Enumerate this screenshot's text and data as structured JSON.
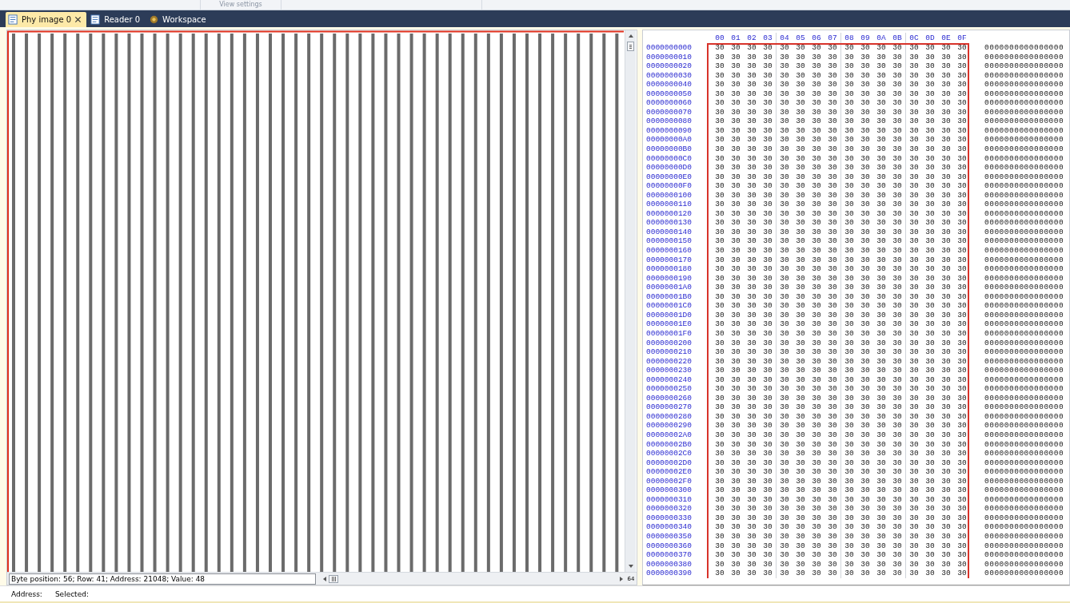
{
  "ribbon": {
    "group_label": "View settings"
  },
  "tabs": [
    {
      "label": "Phy image 0",
      "selected": true,
      "closable": true,
      "kind": "document"
    },
    {
      "label": "Reader 0",
      "selected": false,
      "closable": false,
      "kind": "document"
    },
    {
      "label": "Workspace",
      "selected": false,
      "closable": false,
      "kind": "workspace"
    }
  ],
  "image_view": {
    "status": "Byte position: 56; Row: 41; Address: 21048; Value: 48",
    "zoom": "64"
  },
  "hex_view": {
    "columns": [
      "00",
      "01",
      "02",
      "03",
      "04",
      "05",
      "06",
      "07",
      "08",
      "09",
      "0A",
      "0B",
      "0C",
      "0D",
      "0E",
      "0F"
    ],
    "rows": [
      {
        "address": "0000000000",
        "bytes": [
          "30",
          "30",
          "30",
          "30",
          "30",
          "30",
          "30",
          "30",
          "30",
          "30",
          "30",
          "30",
          "30",
          "30",
          "30",
          "30"
        ],
        "ascii": "0000000000000000"
      },
      {
        "address": "0000000010",
        "bytes": [
          "30",
          "30",
          "30",
          "30",
          "30",
          "30",
          "30",
          "30",
          "30",
          "30",
          "30",
          "30",
          "30",
          "30",
          "30",
          "30"
        ],
        "ascii": "0000000000000000"
      },
      {
        "address": "0000000020",
        "bytes": [
          "30",
          "30",
          "30",
          "30",
          "30",
          "30",
          "30",
          "30",
          "30",
          "30",
          "30",
          "30",
          "30",
          "30",
          "30",
          "30"
        ],
        "ascii": "0000000000000000"
      },
      {
        "address": "0000000030",
        "bytes": [
          "30",
          "30",
          "30",
          "30",
          "30",
          "30",
          "30",
          "30",
          "30",
          "30",
          "30",
          "30",
          "30",
          "30",
          "30",
          "30"
        ],
        "ascii": "0000000000000000"
      },
      {
        "address": "0000000040",
        "bytes": [
          "30",
          "30",
          "30",
          "30",
          "30",
          "30",
          "30",
          "30",
          "30",
          "30",
          "30",
          "30",
          "30",
          "30",
          "30",
          "30"
        ],
        "ascii": "0000000000000000"
      },
      {
        "address": "0000000050",
        "bytes": [
          "30",
          "30",
          "30",
          "30",
          "30",
          "30",
          "30",
          "30",
          "30",
          "30",
          "30",
          "30",
          "30",
          "30",
          "30",
          "30"
        ],
        "ascii": "0000000000000000"
      },
      {
        "address": "0000000060",
        "bytes": [
          "30",
          "30",
          "30",
          "30",
          "30",
          "30",
          "30",
          "30",
          "30",
          "30",
          "30",
          "30",
          "30",
          "30",
          "30",
          "30"
        ],
        "ascii": "0000000000000000"
      },
      {
        "address": "0000000070",
        "bytes": [
          "30",
          "30",
          "30",
          "30",
          "30",
          "30",
          "30",
          "30",
          "30",
          "30",
          "30",
          "30",
          "30",
          "30",
          "30",
          "30"
        ],
        "ascii": "0000000000000000"
      },
      {
        "address": "0000000080",
        "bytes": [
          "30",
          "30",
          "30",
          "30",
          "30",
          "30",
          "30",
          "30",
          "30",
          "30",
          "30",
          "30",
          "30",
          "30",
          "30",
          "30"
        ],
        "ascii": "0000000000000000"
      },
      {
        "address": "0000000090",
        "bytes": [
          "30",
          "30",
          "30",
          "30",
          "30",
          "30",
          "30",
          "30",
          "30",
          "30",
          "30",
          "30",
          "30",
          "30",
          "30",
          "30"
        ],
        "ascii": "0000000000000000"
      },
      {
        "address": "00000000A0",
        "bytes": [
          "30",
          "30",
          "30",
          "30",
          "30",
          "30",
          "30",
          "30",
          "30",
          "30",
          "30",
          "30",
          "30",
          "30",
          "30",
          "30"
        ],
        "ascii": "0000000000000000"
      },
      {
        "address": "00000000B0",
        "bytes": [
          "30",
          "30",
          "30",
          "30",
          "30",
          "30",
          "30",
          "30",
          "30",
          "30",
          "30",
          "30",
          "30",
          "30",
          "30",
          "30"
        ],
        "ascii": "0000000000000000"
      },
      {
        "address": "00000000C0",
        "bytes": [
          "30",
          "30",
          "30",
          "30",
          "30",
          "30",
          "30",
          "30",
          "30",
          "30",
          "30",
          "30",
          "30",
          "30",
          "30",
          "30"
        ],
        "ascii": "0000000000000000"
      },
      {
        "address": "00000000D0",
        "bytes": [
          "30",
          "30",
          "30",
          "30",
          "30",
          "30",
          "30",
          "30",
          "30",
          "30",
          "30",
          "30",
          "30",
          "30",
          "30",
          "30"
        ],
        "ascii": "0000000000000000"
      },
      {
        "address": "00000000E0",
        "bytes": [
          "30",
          "30",
          "30",
          "30",
          "30",
          "30",
          "30",
          "30",
          "30",
          "30",
          "30",
          "30",
          "30",
          "30",
          "30",
          "30"
        ],
        "ascii": "0000000000000000"
      },
      {
        "address": "00000000F0",
        "bytes": [
          "30",
          "30",
          "30",
          "30",
          "30",
          "30",
          "30",
          "30",
          "30",
          "30",
          "30",
          "30",
          "30",
          "30",
          "30",
          "30"
        ],
        "ascii": "0000000000000000"
      },
      {
        "address": "0000000100",
        "bytes": [
          "30",
          "30",
          "30",
          "30",
          "30",
          "30",
          "30",
          "30",
          "30",
          "30",
          "30",
          "30",
          "30",
          "30",
          "30",
          "30"
        ],
        "ascii": "0000000000000000"
      },
      {
        "address": "0000000110",
        "bytes": [
          "30",
          "30",
          "30",
          "30",
          "30",
          "30",
          "30",
          "30",
          "30",
          "30",
          "30",
          "30",
          "30",
          "30",
          "30",
          "30"
        ],
        "ascii": "0000000000000000"
      },
      {
        "address": "0000000120",
        "bytes": [
          "30",
          "30",
          "30",
          "30",
          "30",
          "30",
          "30",
          "30",
          "30",
          "30",
          "30",
          "30",
          "30",
          "30",
          "30",
          "30"
        ],
        "ascii": "0000000000000000"
      },
      {
        "address": "0000000130",
        "bytes": [
          "30",
          "30",
          "30",
          "30",
          "30",
          "30",
          "30",
          "30",
          "30",
          "30",
          "30",
          "30",
          "30",
          "30",
          "30",
          "30"
        ],
        "ascii": "0000000000000000"
      },
      {
        "address": "0000000140",
        "bytes": [
          "30",
          "30",
          "30",
          "30",
          "30",
          "30",
          "30",
          "30",
          "30",
          "30",
          "30",
          "30",
          "30",
          "30",
          "30",
          "30"
        ],
        "ascii": "0000000000000000"
      },
      {
        "address": "0000000150",
        "bytes": [
          "30",
          "30",
          "30",
          "30",
          "30",
          "30",
          "30",
          "30",
          "30",
          "30",
          "30",
          "30",
          "30",
          "30",
          "30",
          "30"
        ],
        "ascii": "0000000000000000"
      },
      {
        "address": "0000000160",
        "bytes": [
          "30",
          "30",
          "30",
          "30",
          "30",
          "30",
          "30",
          "30",
          "30",
          "30",
          "30",
          "30",
          "30",
          "30",
          "30",
          "30"
        ],
        "ascii": "0000000000000000"
      },
      {
        "address": "0000000170",
        "bytes": [
          "30",
          "30",
          "30",
          "30",
          "30",
          "30",
          "30",
          "30",
          "30",
          "30",
          "30",
          "30",
          "30",
          "30",
          "30",
          "30"
        ],
        "ascii": "0000000000000000"
      },
      {
        "address": "0000000180",
        "bytes": [
          "30",
          "30",
          "30",
          "30",
          "30",
          "30",
          "30",
          "30",
          "30",
          "30",
          "30",
          "30",
          "30",
          "30",
          "30",
          "30"
        ],
        "ascii": "0000000000000000"
      },
      {
        "address": "0000000190",
        "bytes": [
          "30",
          "30",
          "30",
          "30",
          "30",
          "30",
          "30",
          "30",
          "30",
          "30",
          "30",
          "30",
          "30",
          "30",
          "30",
          "30"
        ],
        "ascii": "0000000000000000"
      },
      {
        "address": "00000001A0",
        "bytes": [
          "30",
          "30",
          "30",
          "30",
          "30",
          "30",
          "30",
          "30",
          "30",
          "30",
          "30",
          "30",
          "30",
          "30",
          "30",
          "30"
        ],
        "ascii": "0000000000000000"
      },
      {
        "address": "00000001B0",
        "bytes": [
          "30",
          "30",
          "30",
          "30",
          "30",
          "30",
          "30",
          "30",
          "30",
          "30",
          "30",
          "30",
          "30",
          "30",
          "30",
          "30"
        ],
        "ascii": "0000000000000000"
      },
      {
        "address": "00000001C0",
        "bytes": [
          "30",
          "30",
          "30",
          "30",
          "30",
          "30",
          "30",
          "30",
          "30",
          "30",
          "30",
          "30",
          "30",
          "30",
          "30",
          "30"
        ],
        "ascii": "0000000000000000"
      },
      {
        "address": "00000001D0",
        "bytes": [
          "30",
          "30",
          "30",
          "30",
          "30",
          "30",
          "30",
          "30",
          "30",
          "30",
          "30",
          "30",
          "30",
          "30",
          "30",
          "30"
        ],
        "ascii": "0000000000000000"
      },
      {
        "address": "00000001E0",
        "bytes": [
          "30",
          "30",
          "30",
          "30",
          "30",
          "30",
          "30",
          "30",
          "30",
          "30",
          "30",
          "30",
          "30",
          "30",
          "30",
          "30"
        ],
        "ascii": "0000000000000000"
      },
      {
        "address": "00000001F0",
        "bytes": [
          "30",
          "30",
          "30",
          "30",
          "30",
          "30",
          "30",
          "30",
          "30",
          "30",
          "30",
          "30",
          "30",
          "30",
          "30",
          "30"
        ],
        "ascii": "0000000000000000"
      },
      {
        "address": "0000000200",
        "bytes": [
          "30",
          "30",
          "30",
          "30",
          "30",
          "30",
          "30",
          "30",
          "30",
          "30",
          "30",
          "30",
          "30",
          "30",
          "30",
          "30"
        ],
        "ascii": "0000000000000000"
      },
      {
        "address": "0000000210",
        "bytes": [
          "30",
          "30",
          "30",
          "30",
          "30",
          "30",
          "30",
          "30",
          "30",
          "30",
          "30",
          "30",
          "30",
          "30",
          "30",
          "30"
        ],
        "ascii": "0000000000000000"
      },
      {
        "address": "0000000220",
        "bytes": [
          "30",
          "30",
          "30",
          "30",
          "30",
          "30",
          "30",
          "30",
          "30",
          "30",
          "30",
          "30",
          "30",
          "30",
          "30",
          "30"
        ],
        "ascii": "0000000000000000"
      },
      {
        "address": "0000000230",
        "bytes": [
          "30",
          "30",
          "30",
          "30",
          "30",
          "30",
          "30",
          "30",
          "30",
          "30",
          "30",
          "30",
          "30",
          "30",
          "30",
          "30"
        ],
        "ascii": "0000000000000000"
      },
      {
        "address": "0000000240",
        "bytes": [
          "30",
          "30",
          "30",
          "30",
          "30",
          "30",
          "30",
          "30",
          "30",
          "30",
          "30",
          "30",
          "30",
          "30",
          "30",
          "30"
        ],
        "ascii": "0000000000000000"
      },
      {
        "address": "0000000250",
        "bytes": [
          "30",
          "30",
          "30",
          "30",
          "30",
          "30",
          "30",
          "30",
          "30",
          "30",
          "30",
          "30",
          "30",
          "30",
          "30",
          "30"
        ],
        "ascii": "0000000000000000"
      },
      {
        "address": "0000000260",
        "bytes": [
          "30",
          "30",
          "30",
          "30",
          "30",
          "30",
          "30",
          "30",
          "30",
          "30",
          "30",
          "30",
          "30",
          "30",
          "30",
          "30"
        ],
        "ascii": "0000000000000000"
      },
      {
        "address": "0000000270",
        "bytes": [
          "30",
          "30",
          "30",
          "30",
          "30",
          "30",
          "30",
          "30",
          "30",
          "30",
          "30",
          "30",
          "30",
          "30",
          "30",
          "30"
        ],
        "ascii": "0000000000000000"
      },
      {
        "address": "0000000280",
        "bytes": [
          "30",
          "30",
          "30",
          "30",
          "30",
          "30",
          "30",
          "30",
          "30",
          "30",
          "30",
          "30",
          "30",
          "30",
          "30",
          "30"
        ],
        "ascii": "0000000000000000"
      },
      {
        "address": "0000000290",
        "bytes": [
          "30",
          "30",
          "30",
          "30",
          "30",
          "30",
          "30",
          "30",
          "30",
          "30",
          "30",
          "30",
          "30",
          "30",
          "30",
          "30"
        ],
        "ascii": "0000000000000000"
      },
      {
        "address": "00000002A0",
        "bytes": [
          "30",
          "30",
          "30",
          "30",
          "30",
          "30",
          "30",
          "30",
          "30",
          "30",
          "30",
          "30",
          "30",
          "30",
          "30",
          "30"
        ],
        "ascii": "0000000000000000"
      },
      {
        "address": "00000002B0",
        "bytes": [
          "30",
          "30",
          "30",
          "30",
          "30",
          "30",
          "30",
          "30",
          "30",
          "30",
          "30",
          "30",
          "30",
          "30",
          "30",
          "30"
        ],
        "ascii": "0000000000000000"
      },
      {
        "address": "00000002C0",
        "bytes": [
          "30",
          "30",
          "30",
          "30",
          "30",
          "30",
          "30",
          "30",
          "30",
          "30",
          "30",
          "30",
          "30",
          "30",
          "30",
          "30"
        ],
        "ascii": "0000000000000000"
      },
      {
        "address": "00000002D0",
        "bytes": [
          "30",
          "30",
          "30",
          "30",
          "30",
          "30",
          "30",
          "30",
          "30",
          "30",
          "30",
          "30",
          "30",
          "30",
          "30",
          "30"
        ],
        "ascii": "0000000000000000"
      },
      {
        "address": "00000002E0",
        "bytes": [
          "30",
          "30",
          "30",
          "30",
          "30",
          "30",
          "30",
          "30",
          "30",
          "30",
          "30",
          "30",
          "30",
          "30",
          "30",
          "30"
        ],
        "ascii": "0000000000000000"
      },
      {
        "address": "00000002F0",
        "bytes": [
          "30",
          "30",
          "30",
          "30",
          "30",
          "30",
          "30",
          "30",
          "30",
          "30",
          "30",
          "30",
          "30",
          "30",
          "30",
          "30"
        ],
        "ascii": "0000000000000000"
      },
      {
        "address": "0000000300",
        "bytes": [
          "30",
          "30",
          "30",
          "30",
          "30",
          "30",
          "30",
          "30",
          "30",
          "30",
          "30",
          "30",
          "30",
          "30",
          "30",
          "30"
        ],
        "ascii": "0000000000000000"
      },
      {
        "address": "0000000310",
        "bytes": [
          "30",
          "30",
          "30",
          "30",
          "30",
          "30",
          "30",
          "30",
          "30",
          "30",
          "30",
          "30",
          "30",
          "30",
          "30",
          "30"
        ],
        "ascii": "0000000000000000"
      },
      {
        "address": "0000000320",
        "bytes": [
          "30",
          "30",
          "30",
          "30",
          "30",
          "30",
          "30",
          "30",
          "30",
          "30",
          "30",
          "30",
          "30",
          "30",
          "30",
          "30"
        ],
        "ascii": "0000000000000000"
      },
      {
        "address": "0000000330",
        "bytes": [
          "30",
          "30",
          "30",
          "30",
          "30",
          "30",
          "30",
          "30",
          "30",
          "30",
          "30",
          "30",
          "30",
          "30",
          "30",
          "30"
        ],
        "ascii": "0000000000000000"
      },
      {
        "address": "0000000340",
        "bytes": [
          "30",
          "30",
          "30",
          "30",
          "30",
          "30",
          "30",
          "30",
          "30",
          "30",
          "30",
          "30",
          "30",
          "30",
          "30",
          "30"
        ],
        "ascii": "0000000000000000"
      },
      {
        "address": "0000000350",
        "bytes": [
          "30",
          "30",
          "30",
          "30",
          "30",
          "30",
          "30",
          "30",
          "30",
          "30",
          "30",
          "30",
          "30",
          "30",
          "30",
          "30"
        ],
        "ascii": "0000000000000000"
      },
      {
        "address": "0000000360",
        "bytes": [
          "30",
          "30",
          "30",
          "30",
          "30",
          "30",
          "30",
          "30",
          "30",
          "30",
          "30",
          "30",
          "30",
          "30",
          "30",
          "30"
        ],
        "ascii": "0000000000000000"
      },
      {
        "address": "0000000370",
        "bytes": [
          "30",
          "30",
          "30",
          "30",
          "30",
          "30",
          "30",
          "30",
          "30",
          "30",
          "30",
          "30",
          "30",
          "30",
          "30",
          "30"
        ],
        "ascii": "0000000000000000"
      },
      {
        "address": "0000000380",
        "bytes": [
          "30",
          "30",
          "30",
          "30",
          "30",
          "30",
          "30",
          "30",
          "30",
          "30",
          "30",
          "30",
          "30",
          "30",
          "30",
          "30"
        ],
        "ascii": "0000000000000000"
      },
      {
        "address": "0000000390",
        "bytes": [
          "30",
          "30",
          "30",
          "30",
          "30",
          "30",
          "30",
          "30",
          "30",
          "30",
          "30",
          "30",
          "30",
          "30",
          "30",
          "30"
        ],
        "ascii": "0000000000000000"
      }
    ]
  },
  "status_bar": {
    "address_label": "Address:",
    "selected_label": "Selected:"
  }
}
